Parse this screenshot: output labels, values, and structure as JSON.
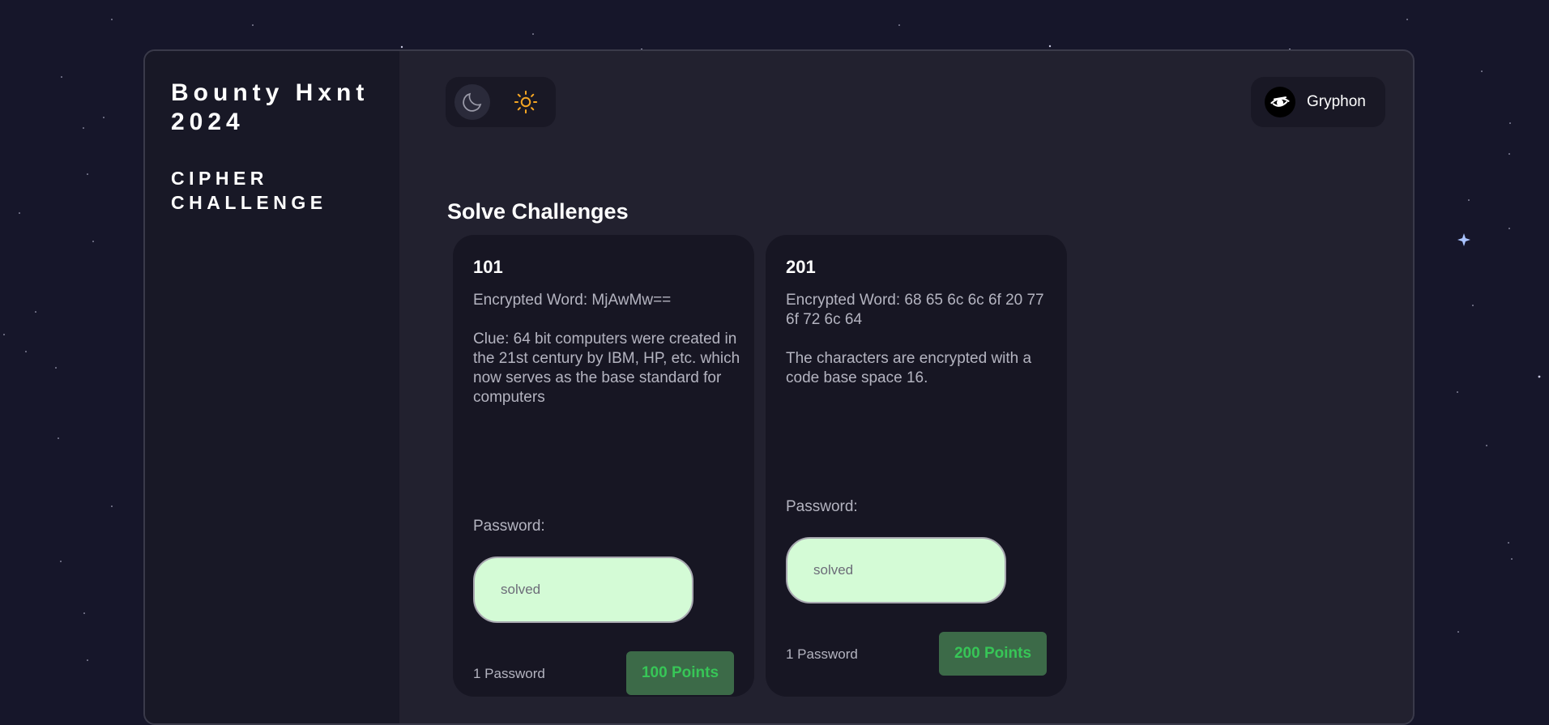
{
  "app": {
    "brand": "Bounty Hxnt 2024",
    "subtitle": "CIPHER CHALLENGE"
  },
  "theme_toggle": {
    "dark_icon": "moon-icon",
    "light_icon": "sun-icon",
    "sun_color": "#f5a623"
  },
  "user": {
    "name": "Gryphon",
    "avatar_icon": "eye-icon"
  },
  "main": {
    "section_title": "Solve Challenges",
    "challenges": [
      {
        "id": "101",
        "encrypted": "Encrypted Word: MjAwMw==",
        "clue": "Clue: 64 bit computers were created in the 21st century by IBM, HP, etc. which now serves as the base standard for computers",
        "password_label": "Password:",
        "password_value": "solved",
        "password_count": "1 Password",
        "points": "100 Points"
      },
      {
        "id": "201",
        "encrypted": "Encrypted Word: 68 65 6c 6c 6f 20 77 6f 72 6c 64",
        "clue": "The characters are encrypted with a code base space 16.",
        "password_label": "Password:",
        "password_value": "solved",
        "password_count": "1 Password",
        "points": "200 Points"
      }
    ]
  },
  "colors": {
    "background": "#16162a",
    "panel": "#22212f",
    "sidebar": "#181826",
    "card": "#171623",
    "input_bg": "#d4fbd6",
    "points_bg": "#3c6a48",
    "points_text": "#37c657"
  }
}
